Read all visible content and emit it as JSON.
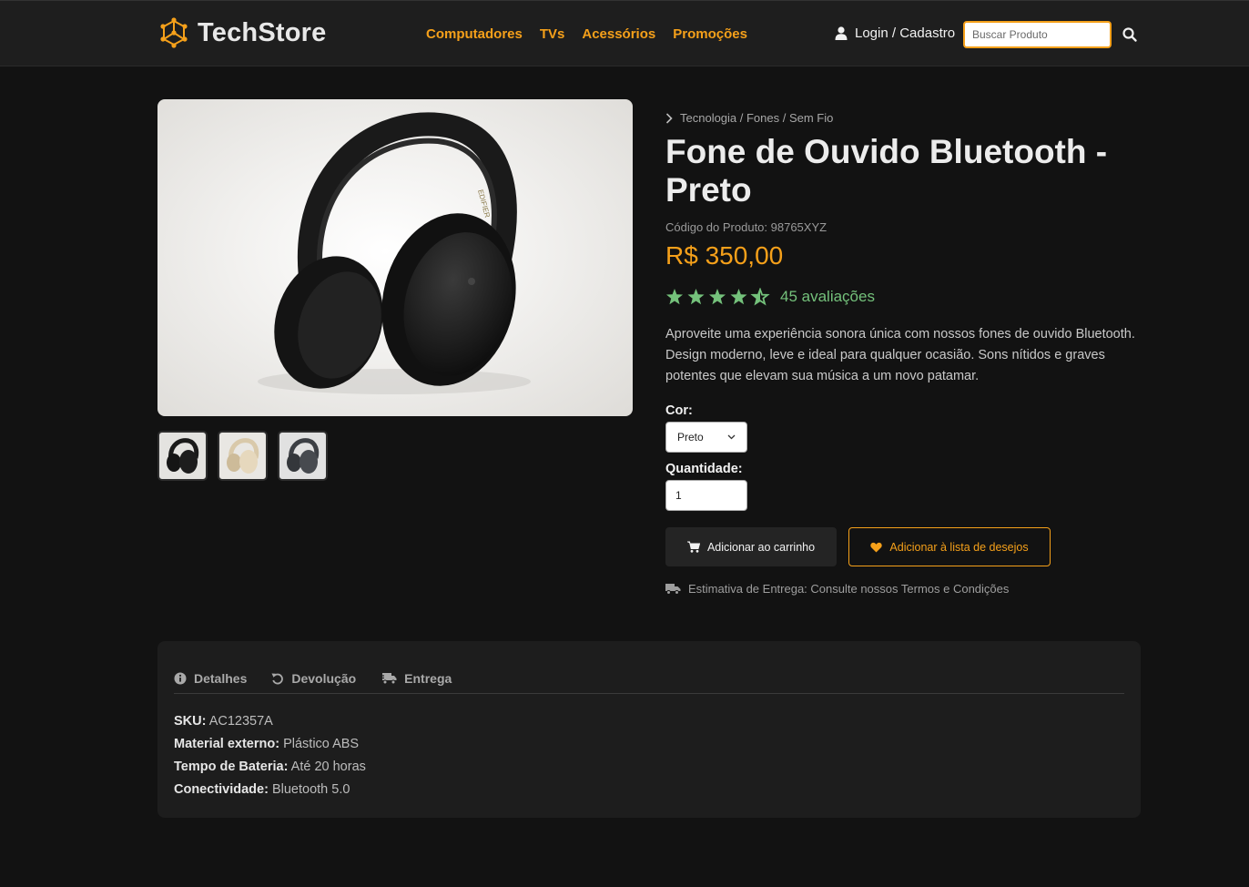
{
  "colors": {
    "accent": "#f5a01a",
    "rating": "#74c17b",
    "background": "#121212",
    "header": "#1e1e1e"
  },
  "header": {
    "brand": "TechStore",
    "logo_icon": "hexagon-cube-icon",
    "nav": [
      "Computadores",
      "TVs",
      "Acessórios",
      "Promoções"
    ],
    "login_label": "Login / Cadastro",
    "search_placeholder": "Buscar Produto"
  },
  "product": {
    "breadcrumb": "Tecnologia / Fones / Sem Fio",
    "title": "Fone de Ouvido Bluetooth - Preto",
    "code": "Código do Produto: 98765XYZ",
    "price": "R$ 350,00",
    "rating": 4.5,
    "reviews": "45 avaliações",
    "description": "Aproveite uma experiência sonora única com nossos fones de ouvido Bluetooth. Design moderno, leve e ideal para qualquer ocasião. Sons nítidos e graves potentes que elevam sua música a um novo patamar.",
    "color_label": "Cor:",
    "color_value": "Preto",
    "quantity_label": "Quantidade:",
    "quantity_value": "1",
    "add_to_cart": "Adicionar ao carrinho",
    "add_to_wishlist": "Adicionar à lista de desejos",
    "delivery_text": "Estimativa de Entrega: Consulte nossos Termos e Condições",
    "thumbnails": [
      "black",
      "cream",
      "gray"
    ]
  },
  "details": {
    "tabs": [
      "Detalhes",
      "Devolução",
      "Entrega"
    ],
    "specs": [
      {
        "label": "SKU:",
        "value": "AC12357A"
      },
      {
        "label": "Material externo:",
        "value": "Plástico ABS"
      },
      {
        "label": "Tempo de Bateria:",
        "value": "Até 20 horas"
      },
      {
        "label": "Conectividade:",
        "value": "Bluetooth 5.0"
      }
    ]
  }
}
